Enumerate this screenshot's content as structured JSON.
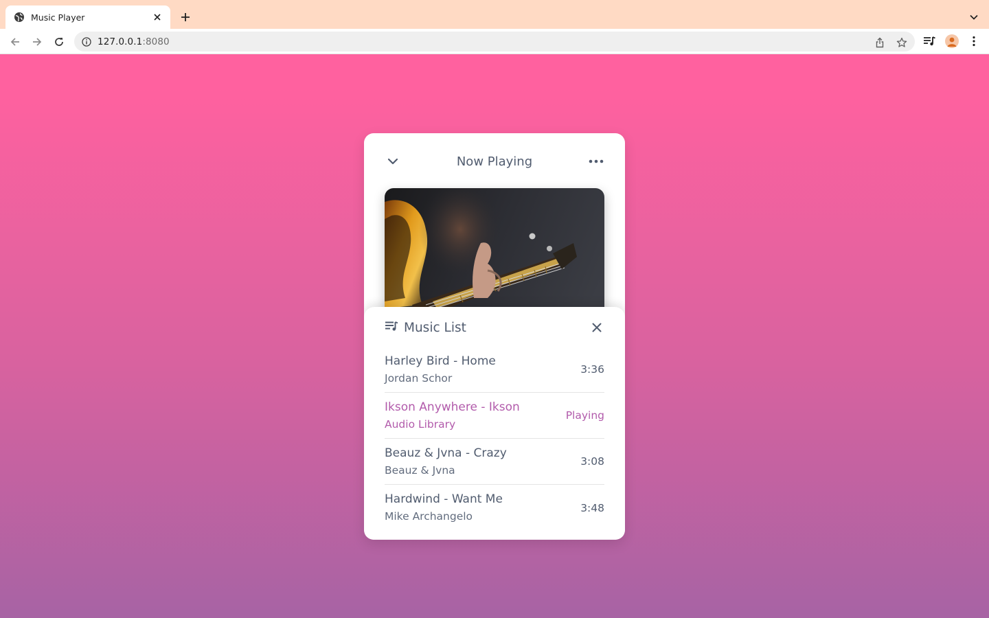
{
  "browser": {
    "tab_title": "Music Player",
    "url_host": "127.0.0.1",
    "url_port": ":8080"
  },
  "colors": {
    "tabbar": "#ffdac4",
    "gradient_top": "#ff619f",
    "gradient_bottom": "#a763a4",
    "text": "#515c6f",
    "accent": "#b25bab"
  },
  "player": {
    "header_title": "Now Playing",
    "icons": [
      "chevron-down-icon",
      "more-horizontal-icon"
    ]
  },
  "music_list": {
    "title": "Music List",
    "songs": [
      {
        "name": "Harley Bird - Home",
        "artist": "Jordan Schor",
        "status": "3:36",
        "playing": false
      },
      {
        "name": "Ikson Anywhere - Ikson",
        "artist": "Audio Library",
        "status": "Playing",
        "playing": true
      },
      {
        "name": "Beauz & Jvna - Crazy",
        "artist": "Beauz & Jvna",
        "status": "3:08",
        "playing": false
      },
      {
        "name": "Hardwind - Want Me",
        "artist": "Mike Archangelo",
        "status": "3:48",
        "playing": false
      }
    ]
  }
}
